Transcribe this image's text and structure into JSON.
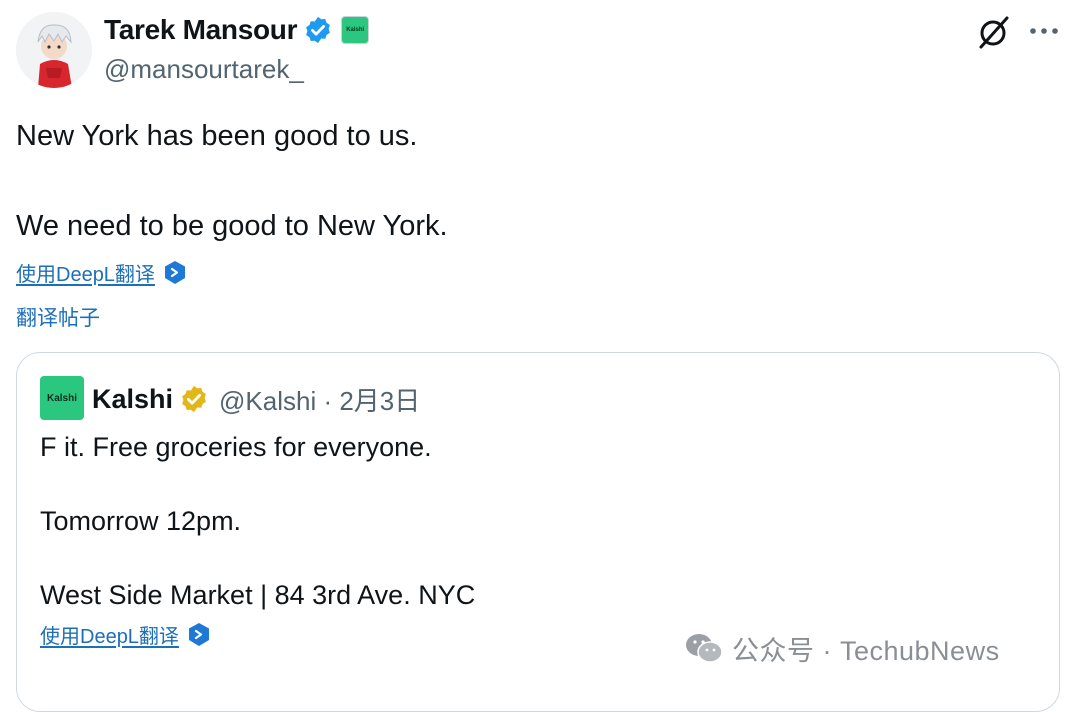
{
  "author": {
    "name": "Tarek Mansour",
    "handle": "@mansourtarek_",
    "affiliate_badge": "Kalshi"
  },
  "tweet": {
    "lines": [
      "New York has been good to us.",
      "We need to be good to New York."
    ],
    "translate_deepl": "使用DeepL翻译",
    "translate_post": "翻译帖子"
  },
  "quote": {
    "logo_text": "Kalshi",
    "name": "Kalshi",
    "meta": "@Kalshi · 2月3日",
    "lines": [
      "F it. Free groceries for everyone.",
      "Tomorrow 12pm.",
      "West Side Market | 84 3rd Ave. NYC"
    ],
    "translate_deepl": "使用DeepL翻译"
  },
  "watermark": "公众号 · TechubNews",
  "icons": {
    "verified": "verified-check-icon",
    "gold_verified": "gold-verified-check-icon",
    "deepl": "deepl-icon",
    "grok": "grok-icon",
    "more": "more-icon",
    "wechat": "wechat-icon"
  },
  "colors": {
    "verified_blue": "#1d9bf0",
    "gold": "#e2b719",
    "kalshi_green": "#2cc77f",
    "link_blue": "#1d6fb8"
  }
}
